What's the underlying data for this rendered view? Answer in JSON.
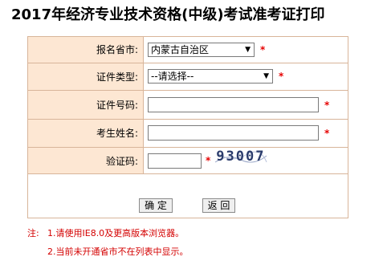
{
  "title": "2017年经济专业技术资格(中级)考试准考证打印",
  "form": {
    "province": {
      "label": "报名省市:",
      "selected": "内蒙古自治区"
    },
    "id_type": {
      "label": "证件类型:",
      "selected": "--请选择--"
    },
    "id_number": {
      "label": "证件号码:",
      "value": ""
    },
    "name": {
      "label": "考生姓名:",
      "value": ""
    },
    "captcha": {
      "label": "验证码:",
      "value": "",
      "image_text": "93007"
    },
    "required_mark": "*"
  },
  "buttons": {
    "confirm": "确 定",
    "back": "返 回"
  },
  "notes": {
    "prefix": "注:",
    "line1": "1.请使用IE8.0及更高版本浏览器。",
    "line2": "2.当前未开通省市不在列表中显示。"
  },
  "colors": {
    "label_bg": "#fde7d3",
    "border": "#d8b59a",
    "required": "#e60000",
    "note": "#d40000"
  }
}
